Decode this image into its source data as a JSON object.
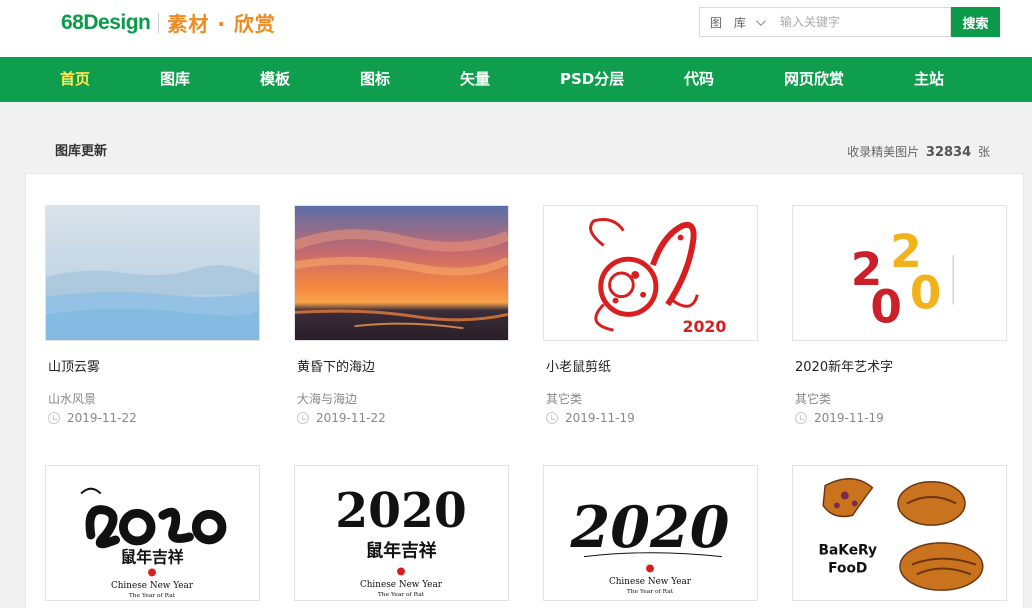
{
  "header": {
    "logo_main": "68Design",
    "logo_sub": "素材 · 欣赏",
    "search": {
      "category": "图 库",
      "placeholder": "输入关键字",
      "button": "搜索"
    }
  },
  "nav": {
    "items": [
      "首页",
      "图库",
      "模板",
      "图标",
      "矢量",
      "PSD分层",
      "代码",
      "网页欣赏",
      "主站"
    ],
    "active_index": 0
  },
  "section": {
    "title": "图库更新",
    "count_prefix": "收录精美图片",
    "count": "32834",
    "count_suffix": "张"
  },
  "cards": [
    {
      "title": "山顶云雾",
      "category": "山水风景",
      "date": "2019-11-22",
      "icon": "mountain-mist-photo"
    },
    {
      "title": "黄昏下的海边",
      "category": "大海与海边",
      "date": "2019-11-22",
      "icon": "sunset-sea-photo"
    },
    {
      "title": "小老鼠剪纸",
      "category": "其它类",
      "date": "2019-11-19",
      "icon": "rat-papercut"
    },
    {
      "title": "2020新年艺术字",
      "category": "其它类",
      "date": "2019-11-19",
      "icon": "2020-art-text"
    },
    {
      "title": "",
      "category": "",
      "date": "",
      "icon": "rat-2020-calligraphy-1"
    },
    {
      "title": "",
      "category": "",
      "date": "",
      "icon": "rat-2020-calligraphy-2"
    },
    {
      "title": "",
      "category": "",
      "date": "",
      "icon": "rat-2020-calligraphy-3"
    },
    {
      "title": "",
      "category": "",
      "date": "",
      "icon": "bakery-food-illustration"
    }
  ],
  "thumb_texts": {
    "year": "2020",
    "blessing": "鼠年吉祥",
    "cny": "Chinese New Year",
    "year_of_rat": "The Year of Rat",
    "bakery": "BaKeRy",
    "food": "FooD"
  },
  "colors": {
    "brand_green": "#0a9a4a",
    "nav_green": "#0f9d4e",
    "nav_active": "#ffe957",
    "logo_orange": "#f08a1c"
  }
}
